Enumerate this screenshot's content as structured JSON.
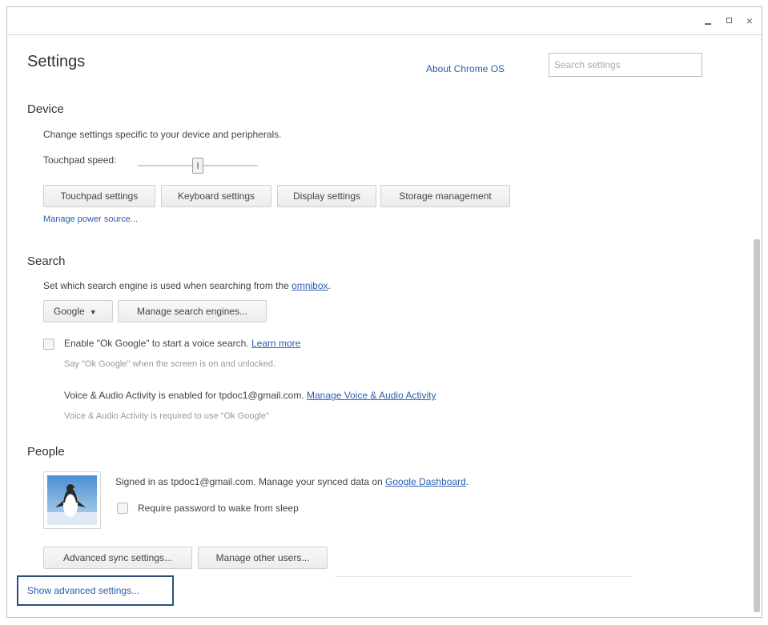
{
  "page": {
    "title": "Settings",
    "about_link": "About Chrome OS",
    "search_placeholder": "Search settings"
  },
  "device": {
    "title": "Device",
    "description": "Change settings specific to your device and peripherals.",
    "touchpad_label": "Touchpad speed:",
    "touchpad_speed_fraction": 0.5,
    "buttons": {
      "touchpad": "Touchpad settings",
      "keyboard": "Keyboard settings",
      "display": "Display settings",
      "storage": "Storage management"
    },
    "power_link": "Manage power source..."
  },
  "search": {
    "title": "Search",
    "description_prefix": "Set which search engine is used when searching from the ",
    "omnibox_link": "omnibox",
    "description_suffix": ".",
    "engine_selected": "Google",
    "manage_engines": "Manage search engines...",
    "ok_google_label": "Enable \"Ok Google\" to start a voice search.",
    "learn_more": "Learn more",
    "ok_google_hint": "Say \"Ok Google\" when the screen is on and unlocked.",
    "voice_activity_text": "Voice & Audio Activity is enabled for tpdoc1@gmail.com.",
    "voice_activity_link": "Manage Voice & Audio Activity",
    "voice_activity_hint": "Voice & Audio Activity is required to use \"Ok Google\""
  },
  "people": {
    "title": "People",
    "signed_in_text": "Signed in as tpdoc1@gmail.com. Manage your synced data on ",
    "dashboard_link": "Google Dashboard",
    "dashboard_suffix": ".",
    "require_password": "Require password to wake from sleep",
    "advanced_sync": "Advanced sync settings...",
    "manage_users": "Manage other users..."
  },
  "footer": {
    "show_advanced": "Show advanced settings..."
  },
  "colors": {
    "link": "#2a5db0",
    "focus_border": "#2d4f7a"
  }
}
